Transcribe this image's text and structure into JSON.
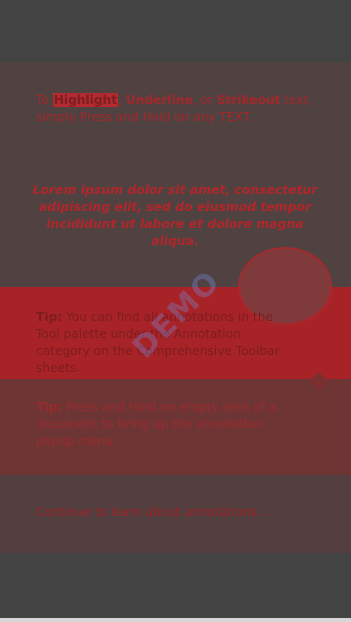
{
  "intro": {
    "prefix": "To ",
    "highlight": "Highlight",
    "comma1": ", ",
    "underline": "Underline",
    "or": ", or ",
    "strikeout": "Strikeout",
    "suffix": " text,",
    "line2": "simply Press and Hold on any TEXT."
  },
  "lorem": "Lorem ipsum dolor sit amet, consectetur adipiscing elit, sed do eiusmod tempor incididunt ut labore et dolore magna aliqua.",
  "tip1": {
    "label": "Tip:",
    "text": " You can find all annotations in the Tool palette under the Annotation category on the Comprehensive Toolbar sheets."
  },
  "tip2": {
    "label": "Tip:",
    "text": " Press and Hold on empty area of a document to bring up the annotation popup menu."
  },
  "continue_text": "Continue to learn about annotations...",
  "watermark": "DEMO",
  "colors": {
    "accent_red": "#a82327",
    "overlay": "#514242",
    "chrome": "#434343"
  }
}
